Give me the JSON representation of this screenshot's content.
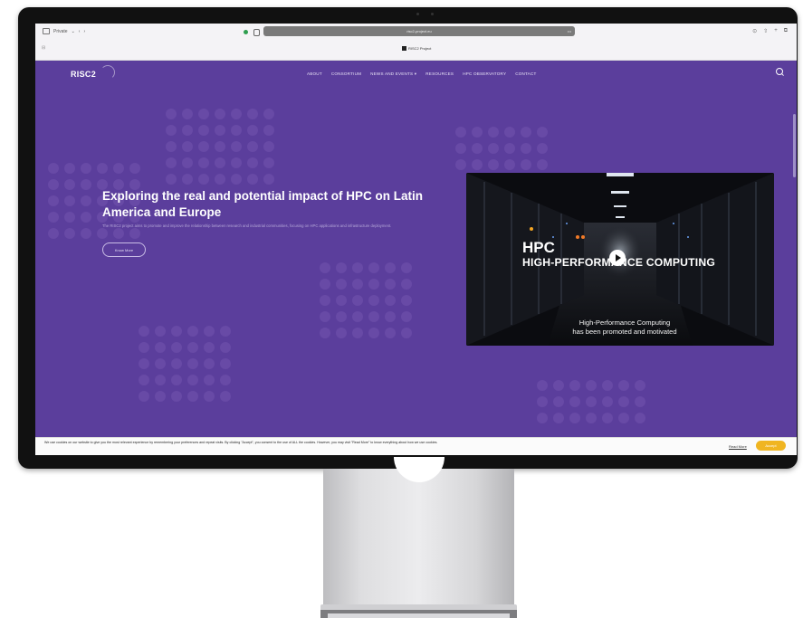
{
  "browser": {
    "private_label": "Private",
    "url": "risc2-project.eu",
    "tab_title": "RISC2 Project"
  },
  "site": {
    "logo": "RISC2",
    "nav": [
      "ABOUT",
      "CONSORTIUM",
      "NEWS AND EVENTS ▾",
      "RESOURCES",
      "HPC OBSERVATORY",
      "CONTACT"
    ],
    "hero": {
      "title": "Exploring the real and potential impact of HPC on Latin America and Europe",
      "description": "The RISC2 project aims to promote and improve the relationship between research and industrial communities, focusing on HPC applications and infrastructure deployment.",
      "button": "Know More"
    },
    "video": {
      "heading": "HPC",
      "subheading": "HIGH-PERFORMANCE COMPUTING",
      "caption_line1": "High-Performance Computing",
      "caption_line2": "has been promoted and motivated"
    }
  },
  "cookie": {
    "text": "We use cookies on our website to give you the most relevant experience by remembering your preferences and repeat visits. By clicking \"Accept\", you consent to the use of ALL the cookies. However, you may visit \"Read More\" to know everything about how we use cookies.",
    "read_more": "Read More",
    "accept": "Accept"
  },
  "colors": {
    "site_bg": "#5b3e9c",
    "accent": "#f0b521"
  }
}
